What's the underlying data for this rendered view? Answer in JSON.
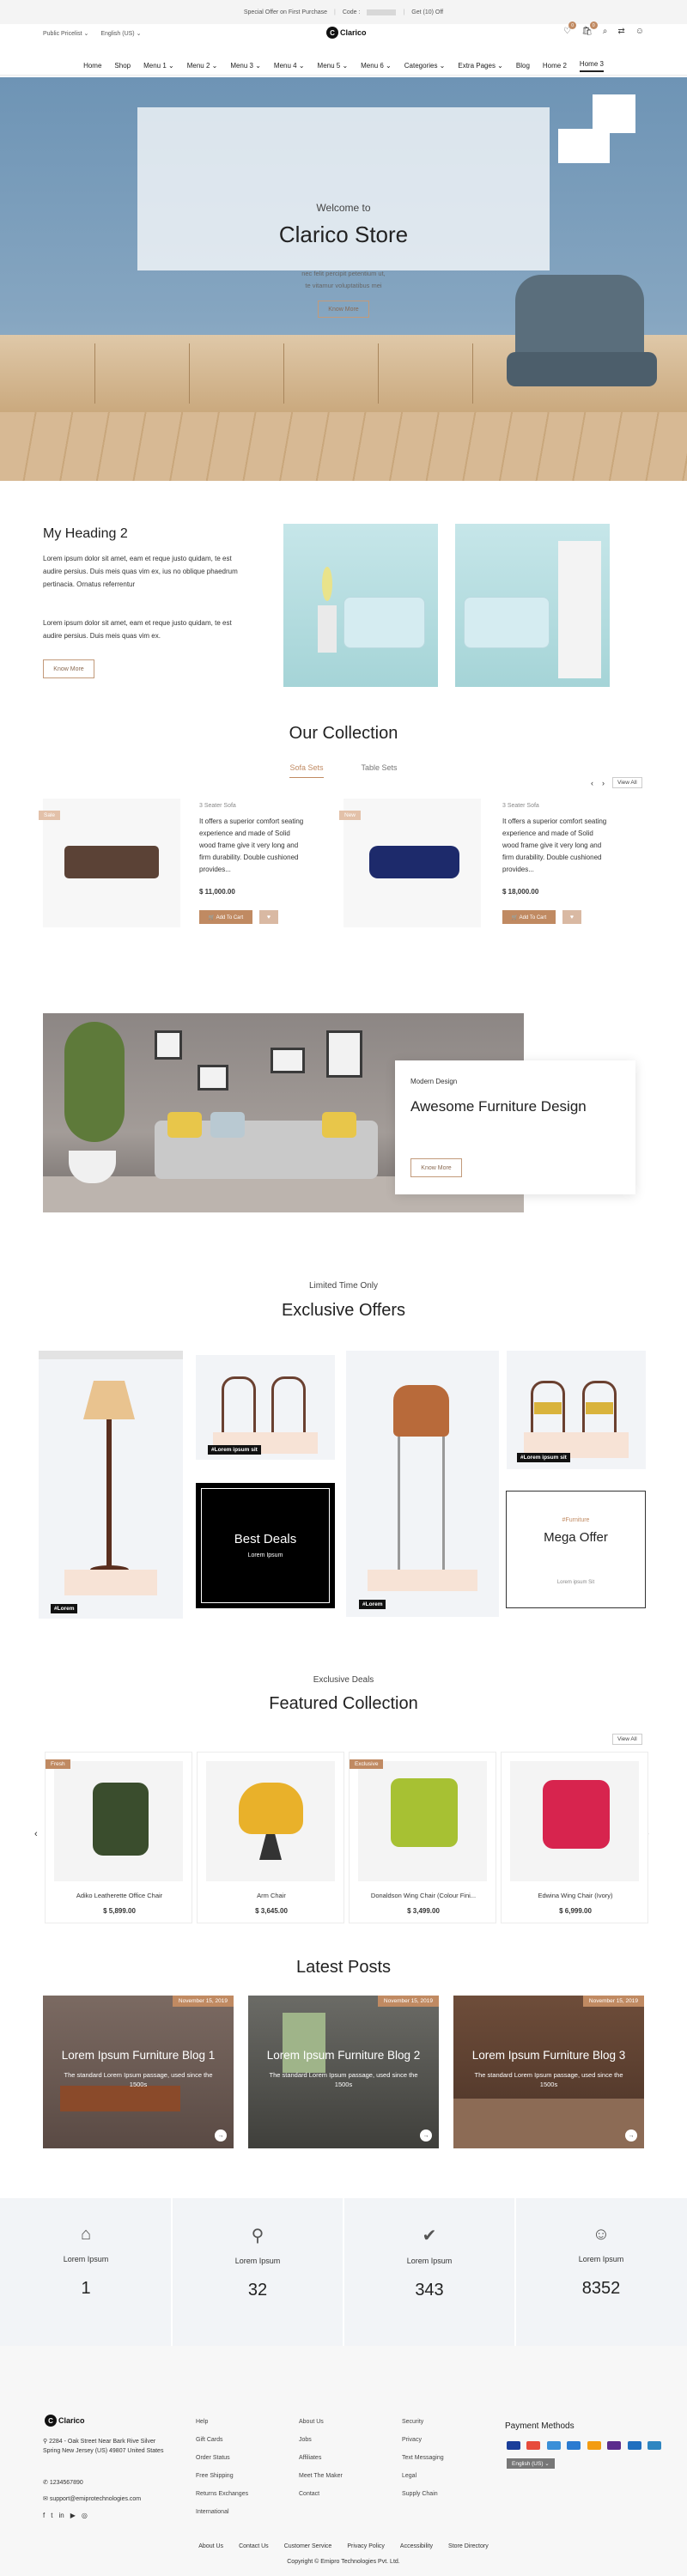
{
  "topbar": {
    "offer": "Special Offer on First Purchase",
    "code_label": "Code :",
    "discount": "Get (10) Off"
  },
  "header": {
    "currency": "Public Pricelist",
    "language": "English (US)",
    "logo_text": "Clarico",
    "cart_count": "0",
    "wishlist_count": "0"
  },
  "nav": [
    "Home",
    "Shop",
    "Menu 1 ⌄",
    "Menu 2 ⌄",
    "Menu 3 ⌄",
    "Menu 4 ⌄",
    "Menu 5 ⌄",
    "Menu 6 ⌄",
    "Categories ⌄",
    "Extra Pages ⌄",
    "Blog",
    "Home 2",
    "Home 3"
  ],
  "hero": {
    "welcome": "Welcome to",
    "title": "Clarico Store",
    "text1": "nec felit percipit petentium ut,",
    "text2": "te vitamur voluptatibus mei",
    "button": "Know More"
  },
  "heading_section": {
    "title": "My Heading 2",
    "para1": "Lorem ipsum dolor sit amet, eam et reque justo quidam, te est audire persius. Duis meis quas vim ex, ius no oblique phaedrum pertinacia. Ornatus referrentur",
    "para2": "Lorem ipsum dolor sit amet, eam et reque justo quidam, te est audire persius. Duis meis quas vim ex.",
    "button": "Know More"
  },
  "collection": {
    "title": "Our Collection",
    "tabs": [
      "Sofa Sets",
      "Table Sets"
    ],
    "view_all": "View All",
    "arrows": [
      "‹",
      "›"
    ],
    "products": [
      {
        "tag": "Sale",
        "category": "3 Seater Sofa",
        "desc": "It offers a superior comfort seating experience and made of Solid wood frame give it very long and firm durability. Double cushioned provides...",
        "price": "$ 11,000.00",
        "cart": "🛒 Add To Cart"
      },
      {
        "tag": "New",
        "category": "3 Seater Sofa",
        "desc": "It offers a superior comfort seating experience and made of Solid wood frame give it very long and firm durability. Double cushioned provides...",
        "price": "$ 18,000.00",
        "cart": "🛒 Add To Cart"
      }
    ]
  },
  "awesome": {
    "kicker": "Modern Design",
    "title": "Awesome Furniture Design",
    "button": "Know More"
  },
  "offers": {
    "kicker": "Limited Time Only",
    "title": "Exclusive Offers",
    "labels": [
      "#Lorem",
      "#Lorem ipsum sit",
      "#Lorem",
      "#Lorem ipsum sit"
    ],
    "best_deals": "Best Deals",
    "best_deals_sub": "Lorem Ipsum",
    "mega_kicker": "#Furniture",
    "mega_title": "Mega Offer",
    "mega_sub": "Lorem ipsum Sit"
  },
  "featured": {
    "kicker": "Exclusive Deals",
    "title": "Featured Collection",
    "view_all": "View All",
    "items": [
      {
        "tag": "Fresh",
        "name": "Adiko Leatherette Office Chair",
        "price": "$ 5,899.00"
      },
      {
        "tag": "",
        "name": "Arm Chair",
        "price": "$ 3,645.00"
      },
      {
        "tag": "Exclusive",
        "name": "Donaldson Wing Chair (Colour Fini...",
        "price": "$ 3,499.00"
      },
      {
        "tag": "",
        "name": "Edwina Wing Chair (Ivory)",
        "price": "$ 6,999.00"
      }
    ]
  },
  "posts": {
    "title": "Latest Posts",
    "items": [
      {
        "date": "November 15, 2019",
        "title": "Lorem Ipsum Furniture Blog 1",
        "text": "The standard Lorem Ipsum passage, used since the 1500s"
      },
      {
        "date": "November 15, 2019",
        "title": "Lorem Ipsum Furniture Blog 2",
        "text": "The standard Lorem Ipsum passage, used since the 1500s"
      },
      {
        "date": "November 15, 2019",
        "title": "Lorem Ipsum Furniture Blog 3",
        "text": "The standard Lorem Ipsum passage, used since the 1500s"
      }
    ]
  },
  "stats": [
    {
      "icon": "home-icon",
      "label": "Lorem Ipsum",
      "value": "1"
    },
    {
      "icon": "location-icon",
      "label": "Lorem Ipsum",
      "value": "32"
    },
    {
      "icon": "check-badge-icon",
      "label": "Lorem Ipsum",
      "value": "343"
    },
    {
      "icon": "smile-icon",
      "label": "Lorem Ipsum",
      "value": "8352"
    }
  ],
  "footer": {
    "logo_text": "Clarico",
    "address": "2284 - Oak Street Near Bark Rive Silver Spring New Jersey (US) 49807 United States",
    "phone": "1234567890",
    "email": "support@emiprotechnologies.com",
    "col1": [
      "Help",
      "Gift Cards",
      "Order Status",
      "Free Shipping",
      "Returns Exchanges",
      "International"
    ],
    "col2": [
      "About Us",
      "Jobs",
      "Affiliates",
      "Meet The Maker",
      "Contact"
    ],
    "col3": [
      "Security",
      "Privacy",
      "Text Messaging",
      "Legal",
      "Supply Chain"
    ],
    "payment_title": "Payment Methods",
    "language": "English (US)",
    "bottom_links": [
      "About Us",
      "Contact Us",
      "Customer Service",
      "Privacy Policy",
      "Accessibility",
      "Store Directory"
    ],
    "copyright": "Copyright © Emipro Technologies Pvt. Ltd."
  },
  "colors": {
    "accent": "#c08a62",
    "accent_light": "#e3c1a9"
  }
}
